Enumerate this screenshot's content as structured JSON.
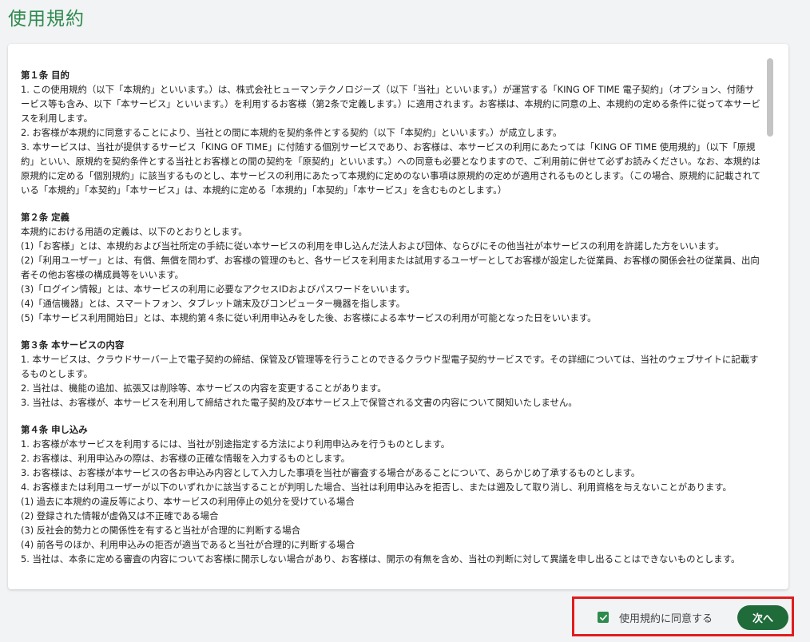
{
  "page": {
    "title": "使用規約"
  },
  "terms": {
    "sections": [
      {
        "heading": "第１条 目的",
        "paragraphs": [
          "1. この使用規約（以下「本規約」といいます。）は、株式会社ヒューマンテクノロジーズ（以下「当社」といいます。）が運営する「KING OF TIME 電子契約」（オプション、付随サービス等も含み、以下「本サービス」といいます。）を利用するお客様（第2条で定義します。）に適用されます。お客様は、本規約に同意の上、本規約の定める条件に従って本サービスを利用します。",
          "2. お客様が本規約に同意することにより、当社との間に本規約を契約条件とする契約（以下「本契約」といいます。）が成立します。",
          "3. 本サービスは、当社が提供するサービス「KING OF TIME」に付随する個別サービスであり、お客様は、本サービスの利用にあたっては「KING OF TIME 使用規約」（以下「原規約」といい、原規約を契約条件とする当社とお客様との間の契約を「原契約」といいます。）への同意も必要となりますので、ご利用前に併せて必ずお読みください。なお、本規約は原規約に定める「個別規約」に該当するものとし、本サービスの利用にあたって本規約に定めのない事項は原規約の定めが適用されるものとします。（この場合、原規約に記載されている「本規約」「本契約」「本サービス」は、本規約に定める「本規約」「本契約」「本サービス」を含むものとします。）"
        ]
      },
      {
        "heading": "第２条 定義",
        "paragraphs": [
          "本規約における用語の定義は、以下のとおりとします。",
          "(1)「お客様」とは、本規約および当社所定の手続に従い本サービスの利用を申し込んだ法人および団体、ならびにその他当社が本サービスの利用を許諾した方をいいます。",
          "(2)「利用ユーザー」とは、有償、無償を問わず、お客様の管理のもと、各サービスを利用または試用するユーザーとしてお客様が設定した従業員、お客様の関係会社の従業員、出向者その他お客様の構成員等をいいます。",
          "(3)「ログイン情報」とは、本サービスの利用に必要なアクセスIDおよびパスワードをいいます。",
          "(4)「通信機器」とは、スマートフォン、タブレット端末及びコンピューター機器を指します。",
          "(5)「本サービス利用開始日」とは、本規約第４条に従い利用申込みをした後、お客様による本サービスの利用が可能となった日をいいます。"
        ]
      },
      {
        "heading": "第３条 本サービスの内容",
        "paragraphs": [
          "1. 本サービスは、クラウドサーバー上で電子契約の締結、保管及び管理等を行うことのできるクラウド型電子契約サービスです。その詳細については、当社のウェブサイトに記載するものとします。",
          "2. 当社は、機能の追加、拡張又は削除等、本サービスの内容を変更することがあります。",
          "3. 当社は、お客様が、本サービスを利用して締結された電子契約及び本サービス上で保管される文書の内容について関知いたしません。"
        ]
      },
      {
        "heading": "第４条 申し込み",
        "paragraphs": [
          "1. お客様が本サービスを利用するには、当社が別途指定する方法により利用申込みを行うものとします。",
          "2. お客様は、利用申込みの際は、お客様の正確な情報を入力するものとします。",
          "3. お客様は、お客様が本サービスの各お申込み内容として入力した事項を当社が審査する場合があることについて、あらかじめ了承するものとします。",
          "4. お客様または利用ユーザーが以下のいずれかに該当することが判明した場合、当社は利用申込みを拒否し、または遡及して取り消し、利用資格を与えないことがあります。",
          "(1) 過去に本規約の違反等により、本サービスの利用停止の処分を受けている場合",
          "(2) 登録された情報が虚偽又は不正確である場合",
          "(3) 反社会的勢力との関係性を有すると当社が合理的に判断する場合",
          "(4) 前各号のほか、利用申込みの拒否が適当であると当社が合理的に判断する場合",
          "5. 当社は、本条に定める審査の内容についてお客様に開示しない場合があり、お客様は、開示の有無を含め、当社の判断に対して異議を申し出ることはできないものとします。"
        ]
      }
    ]
  },
  "footer": {
    "agree_label": "使用規約に同意する",
    "agree_checked": true,
    "next_label": "次へ"
  },
  "colors": {
    "accent": "#2e8b4e",
    "button": "#1f6b3a",
    "highlight_border": "#e01d1d"
  }
}
